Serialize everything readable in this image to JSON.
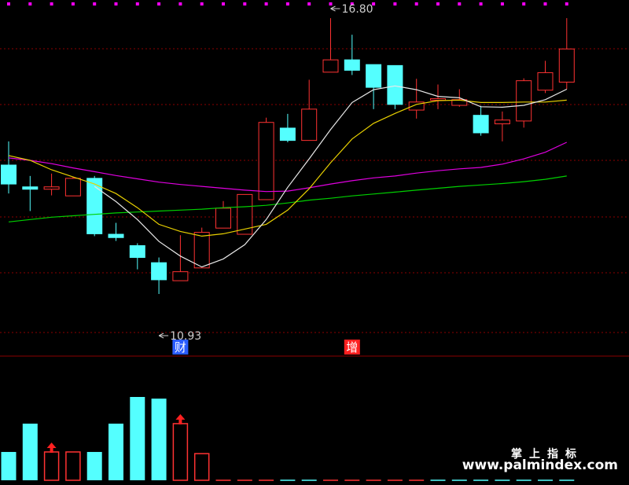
{
  "chart_data": {
    "type": "candlestick",
    "colors": {
      "up": "#ff3232",
      "down": "#54ffff",
      "ma_white": "#e8e8e8",
      "ma_yellow": "#e8d000",
      "ma_magenta": "#e000e0",
      "ma_green": "#00d000",
      "grid": "#8b0000",
      "marker": "#ff00ff"
    },
    "price_range": [
      10.25,
      17.05
    ],
    "candles": [
      {
        "o": 13.7,
        "h": 14.2,
        "l": 13.1,
        "c": 13.3
      },
      {
        "o": 13.24,
        "h": 13.47,
        "l": 12.73,
        "c": 13.19
      },
      {
        "o": 13.19,
        "h": 13.52,
        "l": 13.06,
        "c": 13.24
      },
      {
        "o": 13.05,
        "h": 13.45,
        "l": 13.05,
        "c": 13.42
      },
      {
        "o": 13.42,
        "h": 13.47,
        "l": 12.2,
        "c": 12.25
      },
      {
        "o": 12.24,
        "h": 12.48,
        "l": 12.1,
        "c": 12.17
      },
      {
        "o": 12.0,
        "h": 12.05,
        "l": 11.5,
        "c": 11.75
      },
      {
        "o": 11.64,
        "h": 11.75,
        "l": 10.98,
        "c": 11.28
      },
      {
        "o": 11.26,
        "h": 12.22,
        "l": 11.26,
        "c": 11.45
      },
      {
        "o": 11.53,
        "h": 12.38,
        "l": 11.53,
        "c": 12.28
      },
      {
        "o": 12.37,
        "h": 12.94,
        "l": 12.37,
        "c": 12.79
      },
      {
        "o": 12.24,
        "h": 13.07,
        "l": 12.24,
        "c": 13.08
      },
      {
        "o": 12.97,
        "h": 14.7,
        "l": 12.97,
        "c": 14.6
      },
      {
        "o": 14.48,
        "h": 14.78,
        "l": 14.18,
        "c": 14.22
      },
      {
        "o": 14.22,
        "h": 15.5,
        "l": 14.22,
        "c": 14.88
      },
      {
        "o": 15.66,
        "h": 16.8,
        "l": 15.66,
        "c": 15.92
      },
      {
        "o": 15.92,
        "h": 16.45,
        "l": 15.6,
        "c": 15.7
      },
      {
        "o": 15.82,
        "h": 15.82,
        "l": 14.88,
        "c": 15.34
      },
      {
        "o": 15.8,
        "h": 15.8,
        "l": 14.88,
        "c": 14.98
      },
      {
        "o": 14.86,
        "h": 15.52,
        "l": 14.68,
        "c": 15.03
      },
      {
        "o": 15.08,
        "h": 15.4,
        "l": 14.88,
        "c": 15.1
      },
      {
        "o": 14.96,
        "h": 15.3,
        "l": 14.93,
        "c": 15.08
      },
      {
        "o": 14.75,
        "h": 14.95,
        "l": 14.32,
        "c": 14.38
      },
      {
        "o": 14.57,
        "h": 14.83,
        "l": 14.2,
        "c": 14.65
      },
      {
        "o": 14.63,
        "h": 15.53,
        "l": 14.49,
        "c": 15.48
      },
      {
        "o": 15.28,
        "h": 15.9,
        "l": 15.22,
        "c": 15.65
      },
      {
        "o": 15.45,
        "h": 16.8,
        "l": 15.3,
        "c": 16.15
      }
    ],
    "ma_white": [
      null,
      null,
      null,
      null,
      13.25,
      12.93,
      12.55,
      12.09,
      11.78,
      11.55,
      11.72,
      12.02,
      12.55,
      13.23,
      13.83,
      14.45,
      15.02,
      15.29,
      15.37,
      15.29,
      15.15,
      15.12,
      14.93,
      14.92,
      14.96,
      15.08,
      15.3
    ],
    "ma_yellow": [
      13.9,
      13.8,
      13.6,
      13.45,
      13.3,
      13.1,
      12.8,
      12.45,
      12.3,
      12.2,
      12.25,
      12.35,
      12.45,
      12.75,
      13.2,
      13.75,
      14.25,
      14.58,
      14.79,
      14.98,
      15.06,
      15.07,
      15.02,
      15.02,
      15.03,
      15.03,
      15.07
    ],
    "ma_magenta": [
      13.85,
      13.8,
      13.73,
      13.64,
      13.56,
      13.48,
      13.41,
      13.34,
      13.29,
      13.25,
      13.21,
      13.17,
      13.14,
      13.15,
      13.22,
      13.3,
      13.37,
      13.43,
      13.47,
      13.53,
      13.58,
      13.62,
      13.65,
      13.72,
      13.83,
      13.97,
      14.18
    ],
    "ma_green": [
      12.5,
      12.55,
      12.6,
      12.63,
      12.66,
      12.69,
      12.71,
      12.73,
      12.75,
      12.77,
      12.8,
      12.82,
      12.85,
      12.9,
      12.96,
      13.0,
      13.05,
      13.09,
      13.13,
      13.17,
      13.21,
      13.25,
      13.28,
      13.31,
      13.35,
      13.4,
      13.47
    ],
    "high_label": {
      "text": "16.80",
      "index": 15
    },
    "low_label": {
      "text": "10.93",
      "index": 7
    },
    "event_labels": [
      {
        "text": "财",
        "index": 8,
        "color": "#2a5cff"
      },
      {
        "text": "增",
        "index": 16,
        "color": "#ff2020"
      }
    ],
    "indicator": {
      "bars": [
        {
          "v": 0.34,
          "color": "cyan"
        },
        {
          "v": 0.68,
          "color": "cyan"
        },
        {
          "v": 0.34,
          "color": "red",
          "arrow": true
        },
        {
          "v": 0.34,
          "color": "red"
        },
        {
          "v": 0.34,
          "color": "cyan"
        },
        {
          "v": 0.68,
          "color": "cyan"
        },
        {
          "v": 1.0,
          "color": "cyan"
        },
        {
          "v": 0.98,
          "color": "cyan"
        },
        {
          "v": 0.68,
          "color": "red",
          "arrow": true
        },
        {
          "v": 0.32,
          "color": "red"
        },
        {
          "v": 0,
          "color": "red"
        },
        {
          "v": 0,
          "color": "red"
        },
        {
          "v": 0,
          "color": "red"
        },
        {
          "v": 0,
          "color": "cyan"
        },
        {
          "v": 0,
          "color": "cyan"
        },
        {
          "v": 0,
          "color": "red"
        },
        {
          "v": 0,
          "color": "red"
        },
        {
          "v": 0,
          "color": "red"
        },
        {
          "v": 0,
          "color": "red"
        },
        {
          "v": 0,
          "color": "red"
        },
        {
          "v": 0,
          "color": "cyan"
        },
        {
          "v": 0,
          "color": "cyan"
        },
        {
          "v": 0,
          "color": "cyan"
        },
        {
          "v": 0,
          "color": "cyan"
        },
        {
          "v": 0,
          "color": "cyan"
        },
        {
          "v": 0,
          "color": "cyan"
        },
        {
          "v": 0,
          "color": "cyan"
        }
      ]
    }
  },
  "watermark": {
    "title": "掌上指标",
    "url": "www.palmindex.com"
  }
}
